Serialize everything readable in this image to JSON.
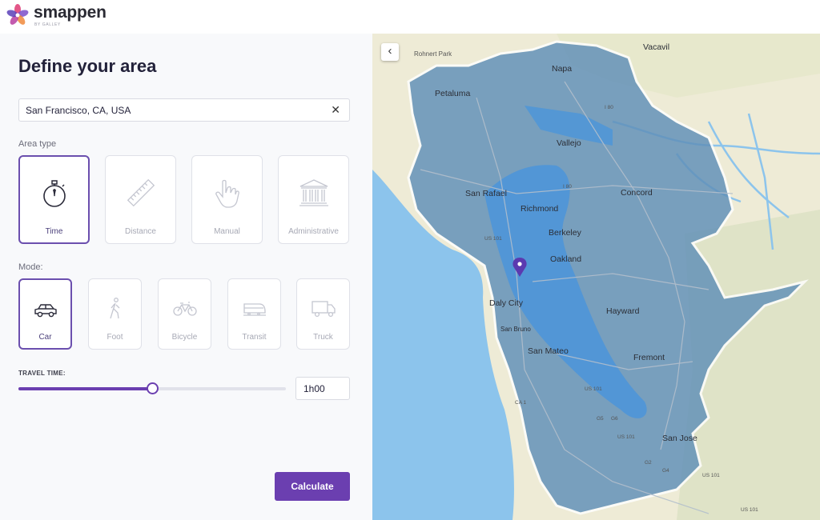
{
  "brand": {
    "name": "smappen",
    "sub": "BY GALLEY"
  },
  "panel": {
    "title": "Define your area",
    "search_value": "San Francisco, CA, USA",
    "area_type_label": "Area type",
    "area_types": [
      {
        "label": "Time",
        "icon": "stopwatch-icon",
        "active": true
      },
      {
        "label": "Distance",
        "icon": "ruler-icon",
        "active": false
      },
      {
        "label": "Manual",
        "icon": "hand-pointer-icon",
        "active": false
      },
      {
        "label": "Administrative",
        "icon": "building-columns-icon",
        "active": false
      }
    ],
    "mode_label": "Mode:",
    "modes": [
      {
        "label": "Car",
        "icon": "car-icon",
        "active": true
      },
      {
        "label": "Foot",
        "icon": "walking-icon",
        "active": false
      },
      {
        "label": "Bicycle",
        "icon": "bicycle-icon",
        "active": false
      },
      {
        "label": "Transit",
        "icon": "train-icon",
        "active": false
      },
      {
        "label": "Truck",
        "icon": "truck-icon",
        "active": false
      }
    ],
    "travel_time_label": "TRAVEL TIME:",
    "travel_time_value": "1h00",
    "travel_time_fraction": 0.5,
    "calculate_label": "Calculate"
  },
  "map": {
    "places": [
      "Napa",
      "Vacavil",
      "Petaluma",
      "Vallejo",
      "San Rafael",
      "Richmond",
      "Concord",
      "Berkeley",
      "Oakland",
      "Daly City",
      "San Bruno",
      "Hayward",
      "San Mateo",
      "Fremont",
      "San Jose",
      "Rohnert Park"
    ],
    "road_shields": [
      "I 80",
      "I 80",
      "US 101",
      "CA 1",
      "US 101",
      "G5",
      "G6",
      "US 101",
      "G2",
      "G4",
      "US 101",
      "US 101"
    ]
  },
  "colors": {
    "accent": "#6b3fb0",
    "isochrone": "#5f8fb8",
    "water": "#8cc4ec"
  }
}
